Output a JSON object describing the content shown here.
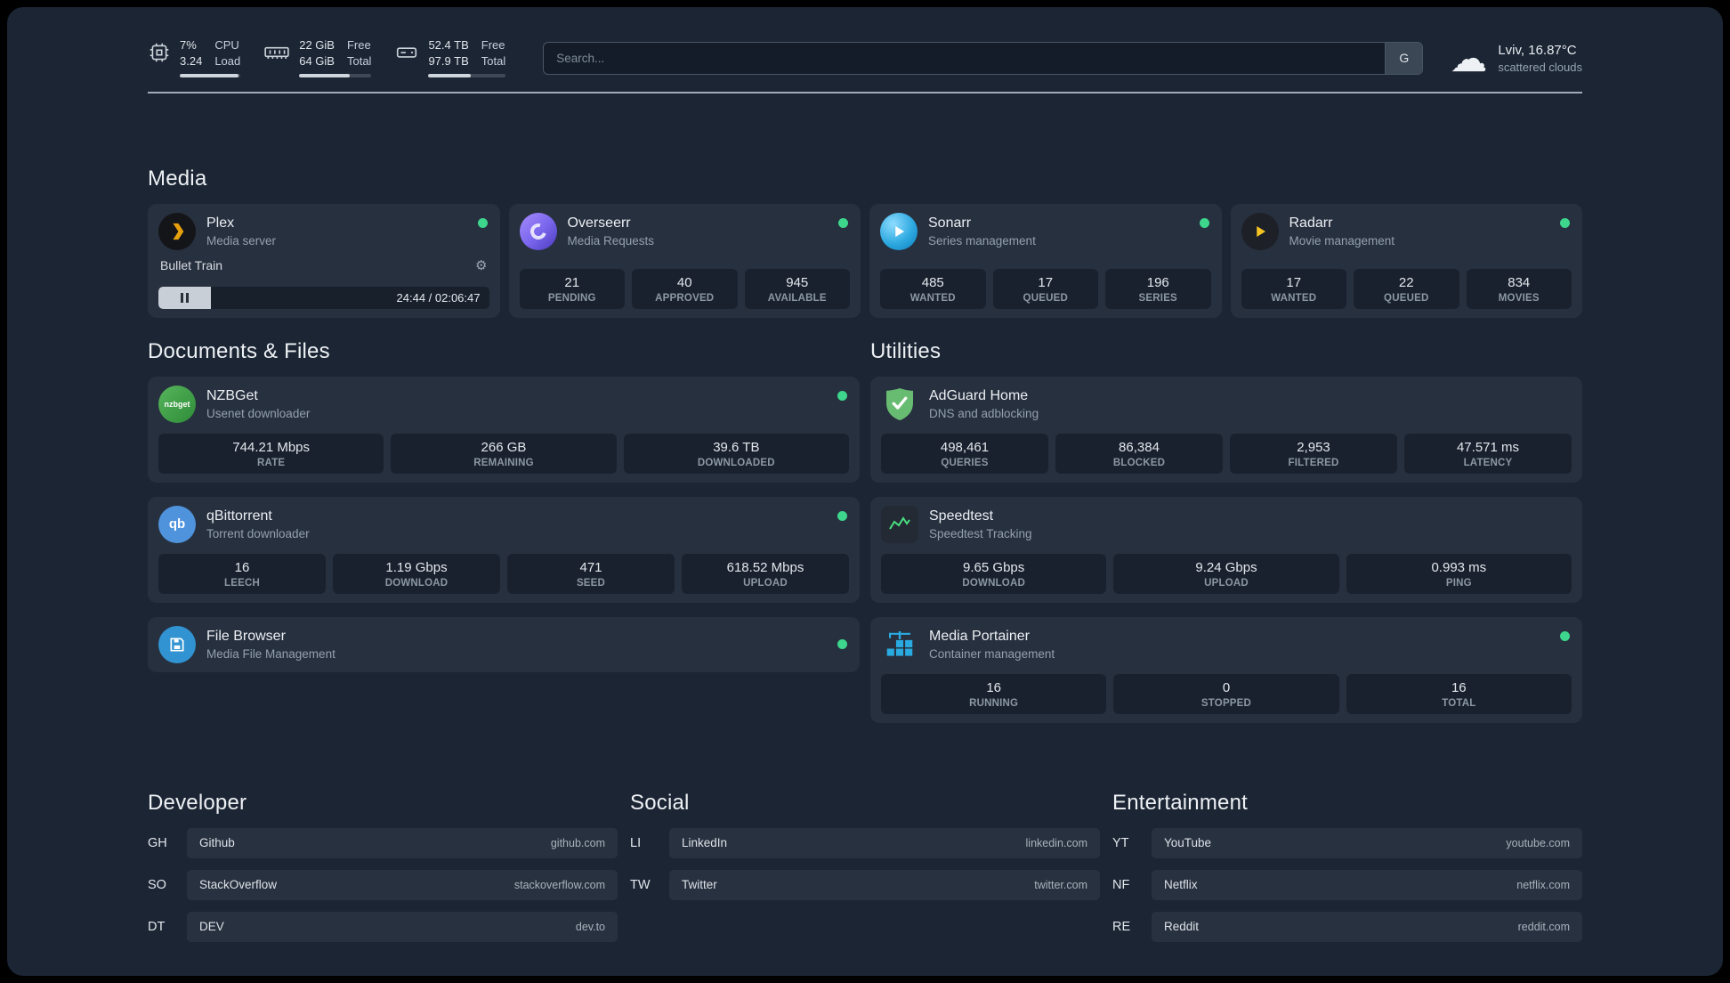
{
  "colors": {
    "background": "#1b2534",
    "status_online": "#3dd68c",
    "plex_accent": "#e5a00d",
    "radarr_accent": "#f6c324",
    "sonarr_blue": "#2ea9e0",
    "adguard_green": "#68bc71",
    "portainer_blue": "#29abe2",
    "speedtest_line": "#4ade80"
  },
  "topbar": {
    "cpu": {
      "value_top": "7%",
      "value_bottom": "3.24",
      "label_top": "CPU",
      "label_bottom": "Load",
      "fill": 96
    },
    "memory": {
      "value_top": "22 GiB",
      "value_bottom": "64 GiB",
      "label_top": "Free",
      "label_bottom": "Total",
      "fill": 70
    },
    "disk": {
      "value_top": "52.4 TB",
      "value_bottom": "97.9 TB",
      "label_top": "Free",
      "label_bottom": "Total",
      "fill": 55
    },
    "search": {
      "placeholder": "Search...",
      "provider": "G"
    },
    "weather": {
      "location": "Lviv, 16.87°C",
      "condition": "scattered clouds"
    }
  },
  "sections": {
    "media": "Media",
    "documents": "Documents & Files",
    "utilities": "Utilities"
  },
  "services": {
    "plex": {
      "name": "Plex",
      "desc": "Media server",
      "now_playing": "Bullet Train",
      "time": "24:44 / 02:06:47",
      "progress": 16
    },
    "overseerr": {
      "name": "Overseerr",
      "desc": "Media Requests",
      "stats": [
        {
          "value": "21",
          "label": "PENDING"
        },
        {
          "value": "40",
          "label": "APPROVED"
        },
        {
          "value": "945",
          "label": "AVAILABLE"
        }
      ]
    },
    "sonarr": {
      "name": "Sonarr",
      "desc": "Series management",
      "stats": [
        {
          "value": "485",
          "label": "WANTED"
        },
        {
          "value": "17",
          "label": "QUEUED"
        },
        {
          "value": "196",
          "label": "SERIES"
        }
      ]
    },
    "radarr": {
      "name": "Radarr",
      "desc": "Movie management",
      "stats": [
        {
          "value": "17",
          "label": "WANTED"
        },
        {
          "value": "22",
          "label": "QUEUED"
        },
        {
          "value": "834",
          "label": "MOVIES"
        }
      ]
    },
    "nzbget": {
      "name": "NZBGet",
      "desc": "Usenet downloader",
      "icon_text": "nzbget",
      "stats": [
        {
          "value": "744.21 Mbps",
          "label": "RATE"
        },
        {
          "value": "266 GB",
          "label": "REMAINING"
        },
        {
          "value": "39.6 TB",
          "label": "DOWNLOADED"
        }
      ]
    },
    "qbittorrent": {
      "name": "qBittorrent",
      "desc": "Torrent downloader",
      "icon_text": "qb",
      "stats": [
        {
          "value": "16",
          "label": "LEECH"
        },
        {
          "value": "1.19 Gbps",
          "label": "DOWNLOAD"
        },
        {
          "value": "471",
          "label": "SEED"
        },
        {
          "value": "618.52 Mbps",
          "label": "UPLOAD"
        }
      ]
    },
    "filebrowser": {
      "name": "File Browser",
      "desc": "Media File Management"
    },
    "adguard": {
      "name": "AdGuard Home",
      "desc": "DNS and adblocking",
      "stats": [
        {
          "value": "498,461",
          "label": "QUERIES"
        },
        {
          "value": "86,384",
          "label": "BLOCKED"
        },
        {
          "value": "2,953",
          "label": "FILTERED"
        },
        {
          "value": "47.571 ms",
          "label": "LATENCY"
        }
      ]
    },
    "speedtest": {
      "name": "Speedtest",
      "desc": "Speedtest Tracking",
      "stats": [
        {
          "value": "9.65 Gbps",
          "label": "DOWNLOAD"
        },
        {
          "value": "9.24 Gbps",
          "label": "UPLOAD"
        },
        {
          "value": "0.993 ms",
          "label": "PING"
        }
      ]
    },
    "portainer": {
      "name": "Media Portainer",
      "desc": "Container management",
      "stats": [
        {
          "value": "16",
          "label": "RUNNING"
        },
        {
          "value": "0",
          "label": "STOPPED"
        },
        {
          "value": "16",
          "label": "TOTAL"
        }
      ]
    }
  },
  "bookmarks": [
    {
      "title": "Developer",
      "items": [
        {
          "abbr": "GH",
          "name": "Github",
          "url": "github.com"
        },
        {
          "abbr": "SO",
          "name": "StackOverflow",
          "url": "stackoverflow.com"
        },
        {
          "abbr": "DT",
          "name": "DEV",
          "url": "dev.to"
        }
      ]
    },
    {
      "title": "Social",
      "items": [
        {
          "abbr": "LI",
          "name": "LinkedIn",
          "url": "linkedin.com"
        },
        {
          "abbr": "TW",
          "name": "Twitter",
          "url": "twitter.com"
        }
      ]
    },
    {
      "title": "Entertainment",
      "items": [
        {
          "abbr": "YT",
          "name": "YouTube",
          "url": "youtube.com"
        },
        {
          "abbr": "NF",
          "name": "Netflix",
          "url": "netflix.com"
        },
        {
          "abbr": "RE",
          "name": "Reddit",
          "url": "reddit.com"
        }
      ]
    }
  ]
}
